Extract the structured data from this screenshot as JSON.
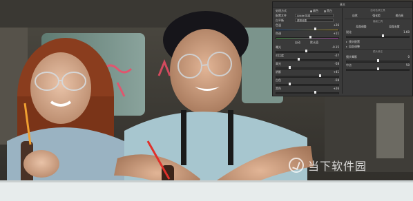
{
  "panel": {
    "title": "基本",
    "treatment": {
      "label": "处理方式",
      "opt_color": "颜色",
      "opt_bw": "黑白"
    },
    "profile": {
      "label": "配置文件",
      "value": "Adobe 标准"
    },
    "wb": {
      "label": "白平衡",
      "value": "原照设置"
    },
    "sliders_left": [
      {
        "label": "色温",
        "value": "+26",
        "knob": 0.62,
        "grad": "temp"
      },
      {
        "label": "色调",
        "value": "+11",
        "knob": 0.55,
        "grad": "tint"
      }
    ],
    "auto_row": {
      "auto": "自动",
      "default": "默认值"
    },
    "sliders_tone": [
      {
        "label": "曝光",
        "value": "-0.15",
        "knob": 0.48
      },
      {
        "label": "对比度",
        "value": "-27",
        "knob": 0.36
      },
      {
        "label": "高光",
        "value": "-58",
        "knob": 0.22
      },
      {
        "label": "阴影",
        "value": "+41",
        "knob": 0.7
      },
      {
        "label": "白色",
        "value": "-58",
        "knob": 0.22
      },
      {
        "label": "黑色",
        "value": "+26",
        "knob": 0.62
      }
    ],
    "right": {
      "section_tone": "自动色调工具",
      "btn_row1": [
        "自然",
        "强化脸",
        "美白高"
      ],
      "section_effect": "高级工具",
      "btn_row2": [
        "局部调整",
        "局部去雾"
      ],
      "sharpen": {
        "label": "锐化",
        "value": "1.60",
        "knob": 0.58
      },
      "row_lens": "镜头配置",
      "row_detail": "局部调整",
      "section_vignette": "镜头矫正",
      "vignette": {
        "label": "镜头晕影",
        "value": "0",
        "knob": 0.5
      },
      "midpoint": {
        "label": "中点",
        "value": "50",
        "knob": 0.5
      }
    }
  },
  "watermark": {
    "text": "当下软件园"
  },
  "colors": {
    "panel_bg": "#3a3a3a",
    "accent": "#e8e8e8",
    "photo_sky": "#6f8f8a"
  }
}
